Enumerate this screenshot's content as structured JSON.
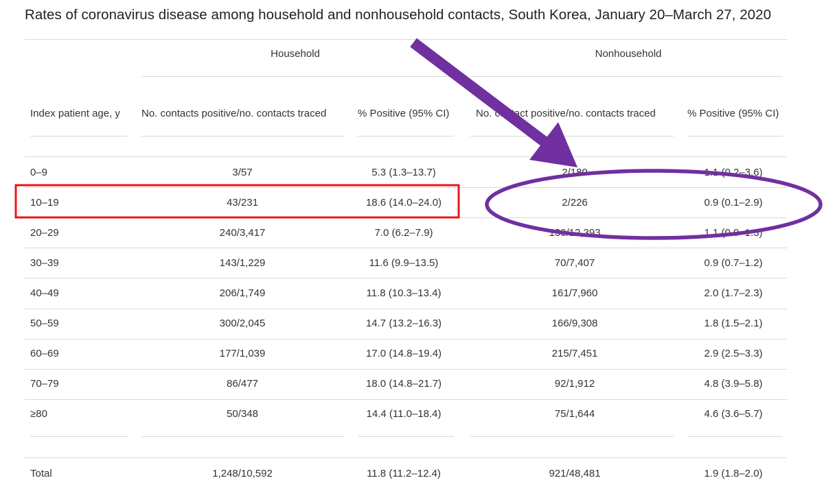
{
  "title": "Rates of coronavirus disease among household and nonhousehold contacts, South Korea, January 20–March 27, 2020",
  "groups": {
    "household": "Household",
    "nonhousehold": "Nonhousehold"
  },
  "columns": {
    "age": "Index patient age, y",
    "hh_count": "No. contacts positive/no. contacts traced",
    "hh_pct": "% Positive (95% CI)",
    "nh_count": "No. contact positive/no. contacts traced",
    "nh_pct": "% Positive (95% CI)"
  },
  "rows": [
    {
      "age": "0–9",
      "hh_count": "3/57",
      "hh_pct": "5.3 (1.3–13.7)",
      "nh_count": "2/180",
      "nh_pct": "1.1 (0.2–3.6)"
    },
    {
      "age": "10–19",
      "hh_count": "43/231",
      "hh_pct": "18.6 (14.0–24.0)",
      "nh_count": "2/226",
      "nh_pct": "0.9 (0.1–2.9)"
    },
    {
      "age": "20–29",
      "hh_count": "240/3,417",
      "hh_pct": "7.0 (6.2–7.9)",
      "nh_count": "130/12,393",
      "nh_pct": "1.1 (0.9–1.3)"
    },
    {
      "age": "30–39",
      "hh_count": "143/1,229",
      "hh_pct": "11.6 (9.9–13.5)",
      "nh_count": "70/7,407",
      "nh_pct": "0.9 (0.7–1.2)"
    },
    {
      "age": "40–49",
      "hh_count": "206/1,749",
      "hh_pct": "11.8 (10.3–13.4)",
      "nh_count": "161/7,960",
      "nh_pct": "2.0 (1.7–2.3)"
    },
    {
      "age": "50–59",
      "hh_count": "300/2,045",
      "hh_pct": "14.7 (13.2–16.3)",
      "nh_count": "166/9,308",
      "nh_pct": "1.8 (1.5–2.1)"
    },
    {
      "age": "60–69",
      "hh_count": "177/1,039",
      "hh_pct": "17.0 (14.8–19.4)",
      "nh_count": "215/7,451",
      "nh_pct": "2.9 (2.5–3.3)"
    },
    {
      "age": "70–79",
      "hh_count": "86/477",
      "hh_pct": "18.0 (14.8–21.7)",
      "nh_count": "92/1,912",
      "nh_pct": "4.8 (3.9–5.8)"
    },
    {
      "age": "≥80",
      "hh_count": "50/348",
      "hh_pct": "14.4 (11.0–18.4)",
      "nh_count": "75/1,644",
      "nh_pct": "4.6 (3.6–5.7)"
    }
  ],
  "total": {
    "age": "Total",
    "hh_count": "1,248/10,592",
    "hh_pct": "11.8 (11.2–12.4)",
    "nh_count": "921/48,481",
    "nh_pct": "1.9 (1.8–2.0)"
  },
  "annotations": {
    "highlight_box_color": "#e8141b",
    "arrow_color": "#7030a0",
    "ellipse_color": "#7030a0"
  }
}
